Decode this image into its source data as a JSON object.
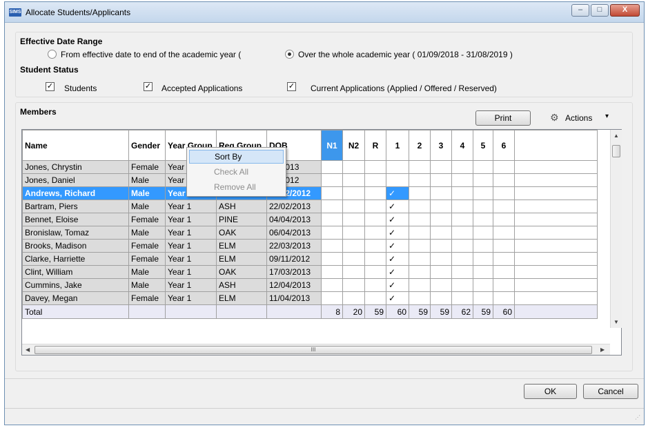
{
  "window": {
    "title": "Allocate Students/Applicants",
    "app_icon_text": "SIMS"
  },
  "title_buttons": {
    "minimize": "–",
    "maximize": "□",
    "close": "X"
  },
  "date_range": {
    "heading": "Effective Date Range",
    "option1": "From effective date to end of the academic year (",
    "option2": "Over the whole academic year ( 01/09/2018 - 31/08/2019 )",
    "selected": "option2"
  },
  "student_status": {
    "heading": "Student Status",
    "students": "Students",
    "accepted": "Accepted Applications",
    "current": "Current Applications (Applied / Offered / Reserved)",
    "check_mark": "✓"
  },
  "members": {
    "heading": "Members",
    "print_label": "Print",
    "actions_label": "Actions",
    "actions_caret": "▾"
  },
  "grid": {
    "columns": [
      "Name",
      "Gender",
      "Year Group",
      "Reg Group",
      "DOB",
      "N1",
      "N2",
      "R",
      "1",
      "2",
      "3",
      "4",
      "5",
      "6"
    ],
    "rows": [
      {
        "name": "Jones, Chrystin",
        "gender": "Female",
        "year": "Year 1",
        "reg": "",
        "dob": "03/2013",
        "tick": false
      },
      {
        "name": "Jones, Daniel",
        "gender": "Male",
        "year": "Year 1",
        "reg": "",
        "dob": "12/2012",
        "tick": false
      },
      {
        "name": "Andrews, Richard",
        "gender": "Male",
        "year": "Year 1",
        "reg": "ASH",
        "dob": "02/12/2012",
        "tick": true,
        "selected": true
      },
      {
        "name": "Bartram, Piers",
        "gender": "Male",
        "year": "Year 1",
        "reg": "ASH",
        "dob": "22/02/2013",
        "tick": true
      },
      {
        "name": "Bennet, Eloise",
        "gender": "Female",
        "year": "Year 1",
        "reg": "PINE",
        "dob": "04/04/2013",
        "tick": true
      },
      {
        "name": "Bronislaw, Tomaz",
        "gender": "Male",
        "year": "Year 1",
        "reg": "OAK",
        "dob": "06/04/2013",
        "tick": true
      },
      {
        "name": "Brooks, Madison",
        "gender": "Female",
        "year": "Year 1",
        "reg": "ELM",
        "dob": "22/03/2013",
        "tick": true
      },
      {
        "name": "Clarke, Harriette",
        "gender": "Female",
        "year": "Year 1",
        "reg": "ELM",
        "dob": "09/11/2012",
        "tick": true
      },
      {
        "name": "Clint, William",
        "gender": "Male",
        "year": "Year 1",
        "reg": "OAK",
        "dob": "17/03/2013",
        "tick": true
      },
      {
        "name": "Cummins, Jake",
        "gender": "Male",
        "year": "Year 1",
        "reg": "ASH",
        "dob": "12/04/2013",
        "tick": true
      },
      {
        "name": "Davey, Megan",
        "gender": "Female",
        "year": "Year 1",
        "reg": "ELM",
        "dob": "11/04/2013",
        "tick": true
      }
    ],
    "tick_char": "✓",
    "total_label": "Total",
    "totals": [
      "8",
      "20",
      "59",
      "60",
      "59",
      "59",
      "62",
      "59",
      "60"
    ]
  },
  "context_menu": {
    "sort_by": "Sort By",
    "check_all": "Check All",
    "remove_all": "Remove All"
  },
  "scrollbar": {
    "up": "▲",
    "down": "▼",
    "left": "◀",
    "right": "▶",
    "grip": "III"
  },
  "footer": {
    "ok_label": "OK",
    "cancel_label": "Cancel",
    "grip": "⋰"
  }
}
